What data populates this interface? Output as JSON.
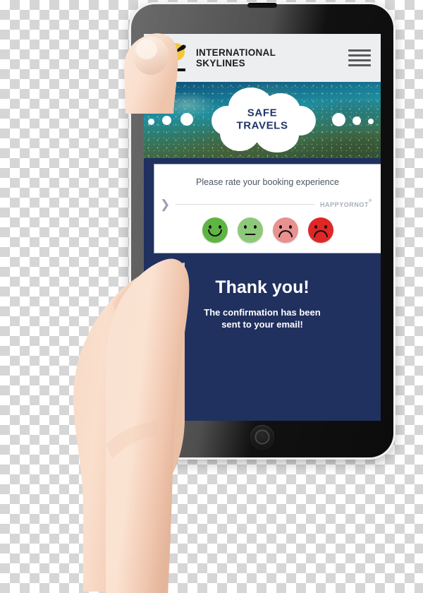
{
  "scene": {
    "description": "Hand holding smartphone showing airline app confirmation screen with HappyOrNot survey",
    "background": "transparent-checkerboard"
  },
  "device": {
    "type": "smartphone",
    "frame_color": "#111111",
    "home_button": "home-button"
  },
  "app": {
    "header": {
      "logo_icon": "airplane-sun-logo-icon",
      "brand_line1": "INTERNATIONAL",
      "brand_line2": "SKYLINES",
      "menu_icon": "hamburger-menu-icon"
    },
    "hero": {
      "banner_line1": "SAFE",
      "banner_line2": "TRAVELS",
      "banner_shape": "cloud",
      "banner_text_color": "#21356b",
      "image_subject": "satellite-earth-coastline-night-lights"
    },
    "survey": {
      "question": "Please rate your booking experience",
      "expand_icon": "chevron-right-icon",
      "vendor_logo": "HAPPYORNOT",
      "vendor_logo_superscript": "®",
      "ratings": [
        {
          "label": "Very happy",
          "expression": "smile",
          "color": "#5fb543",
          "name": "smiley-very-happy"
        },
        {
          "label": "Happy",
          "expression": "flat",
          "color": "#8ec97a",
          "name": "smiley-happy"
        },
        {
          "label": "Unhappy",
          "expression": "frown",
          "color": "#e8918f",
          "name": "smiley-unhappy"
        },
        {
          "label": "Very unhappy",
          "expression": "frown",
          "color": "#e02626",
          "name": "smiley-very-unhappy"
        }
      ]
    },
    "confirmation": {
      "title": "Thank you!",
      "subtitle_line1": "The confirmation has been",
      "subtitle_line2": "sent to your email!",
      "background_color": "#20305f",
      "text_color": "#ffffff"
    }
  }
}
